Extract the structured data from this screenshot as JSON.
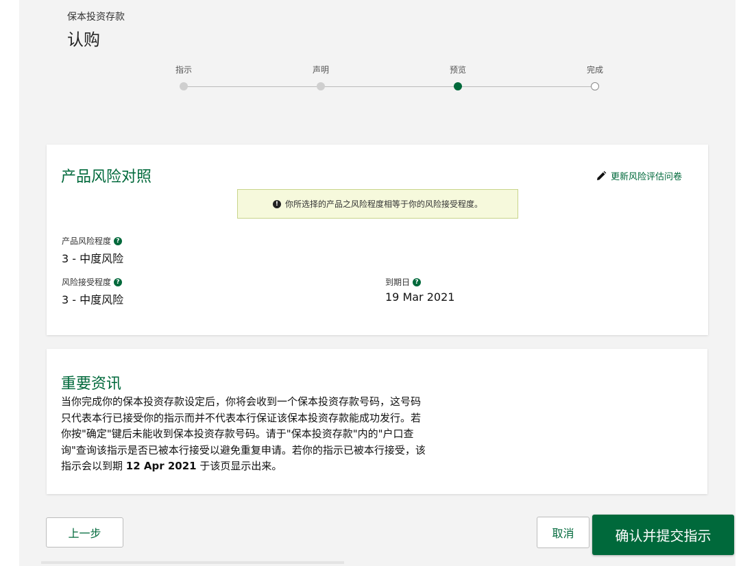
{
  "header": {
    "product_label": "保本投资存款",
    "page_title": "认购"
  },
  "stepper": {
    "steps": [
      {
        "label": "指示",
        "state": "completed"
      },
      {
        "label": "声明",
        "state": "completed"
      },
      {
        "label": "预览",
        "state": "current"
      },
      {
        "label": "完成",
        "state": "future"
      }
    ]
  },
  "risk_card": {
    "title": "产品风险对照",
    "update_link": "更新风险评估问卷",
    "notice": "你所选择的产品之风险程度相等于你的风险接受程度。",
    "fields": {
      "product_risk_label": "产品风险程度",
      "product_risk_value": "3 - 中度风险",
      "risk_tolerance_label": "风险接受程度",
      "risk_tolerance_value": "3 - 中度风险",
      "maturity_label": "到期日",
      "maturity_value": "19 Mar 2021"
    }
  },
  "info_card": {
    "title": "重要资讯",
    "body_line1": "当你完成你的保本投资存款设定后，你将会收到一个保本投资存款号码，这号码",
    "body_line2": "只代表本行已接受你的指示而并不代表本行保证该保本投资存款能成功发行。若",
    "body_line3": "你按\"确定\"键后未能收到保本投资存款号码。请于\"保本投资存款\"内的\"户口查",
    "body_line4": "询\"查询该指示是否已被本行接受以避免重复申请。若你的指示已被本行接受，该",
    "body_line5_pre": "指示会以到期 ",
    "body_line5_date": "12 Apr 2021",
    "body_line5_post": " 于该页显示出来。"
  },
  "actions": {
    "back_label": "上一步",
    "cancel_label": "取消",
    "confirm_label": "确认并提交指示"
  },
  "colors": {
    "brand_green": "#00693b",
    "notice_bg": "#f6f9dc"
  }
}
